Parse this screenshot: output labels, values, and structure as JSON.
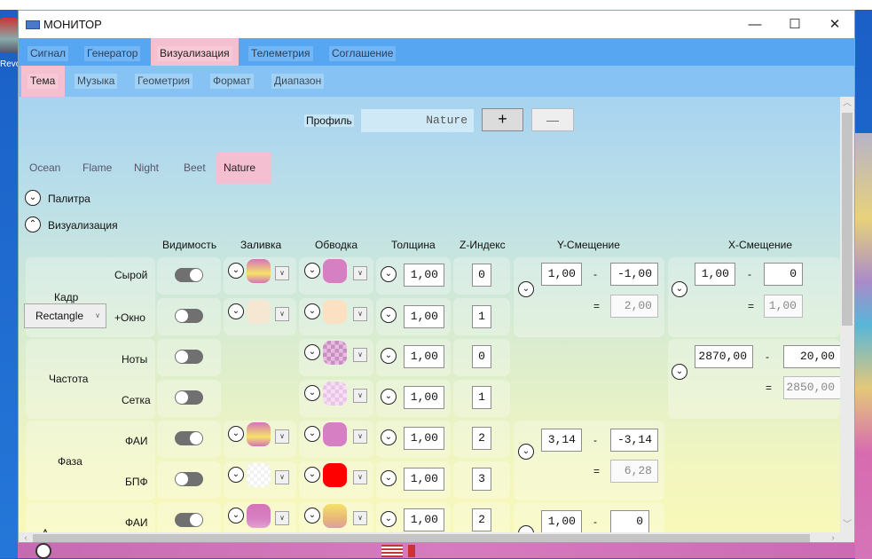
{
  "desktop": {
    "icon_label": "Revo Insta"
  },
  "window": {
    "title": "МОНИТОР",
    "minimize": "—",
    "maximize": "☐",
    "close": "✕"
  },
  "tabs_top": [
    "Сигнал",
    "Генератор",
    "Визуализация",
    "Телеметрия",
    "Соглашение"
  ],
  "tabs_top_active": "Визуализация",
  "tabs_sub": [
    "Тема",
    "Музыка",
    "Геометрия",
    "Формат",
    "Диапазон"
  ],
  "tabs_sub_active": "Тема",
  "profile": {
    "label": "Профиль",
    "value": "Nature",
    "add": "+",
    "remove": "—"
  },
  "profile_tabs": [
    "Ocean",
    "Flame",
    "Night",
    "Beet",
    "Nature"
  ],
  "profile_tabs_active": "Nature",
  "sections": {
    "palette": "Палитра",
    "visual": "Визуализация"
  },
  "headers": {
    "visibility": "Видимость",
    "fill": "Заливка",
    "stroke": "Обводка",
    "thickness": "Толщина",
    "zindex": "Z-Индекс",
    "yoffset": "Y-Смещение",
    "xoffset": "X-Смещение"
  },
  "groups": [
    {
      "name": "Кадр",
      "select": "Rectangle",
      "rows": [
        {
          "label": "Сырой",
          "visible": true,
          "thickness": "1,00",
          "z": "0"
        },
        {
          "label": "+Окно",
          "visible": false,
          "thickness": "1,00",
          "z": "1"
        }
      ],
      "y": {
        "a": "1,00",
        "b": "-1,00",
        "r": "2,00",
        "minus": "-",
        "eq": "="
      },
      "x": {
        "a": "1,00",
        "b": "0",
        "r": "1,00",
        "minus": "-",
        "eq": "="
      }
    },
    {
      "name": "Частота",
      "rows": [
        {
          "label": "Ноты",
          "visible": false,
          "thickness": "1,00",
          "z": "0"
        },
        {
          "label": "Сетка",
          "visible": false,
          "thickness": "1,00",
          "z": "1"
        }
      ],
      "x": {
        "a": "2870,00",
        "b": "20,00",
        "r": "2850,00",
        "minus": "-",
        "eq": "="
      }
    },
    {
      "name": "Фаза",
      "rows": [
        {
          "label": "ФАИ",
          "visible": true,
          "thickness": "1,00",
          "z": "2"
        },
        {
          "label": "БПФ",
          "visible": false,
          "thickness": "1,00",
          "z": "3"
        }
      ],
      "y": {
        "a": "3,14",
        "b": "-3,14",
        "r": "6,28",
        "minus": "-",
        "eq": "="
      }
    },
    {
      "name": "А",
      "rows": [
        {
          "label": "ФАИ",
          "visible": true,
          "thickness": "1,00",
          "z": "2"
        }
      ],
      "y": {
        "a": "1,00",
        "b": "0",
        "minus": "-"
      }
    }
  ],
  "colors": {
    "accent_tab": "#f4bfd0",
    "stroke_red": "#ff0000",
    "stroke_pink": "#d67fc2"
  }
}
